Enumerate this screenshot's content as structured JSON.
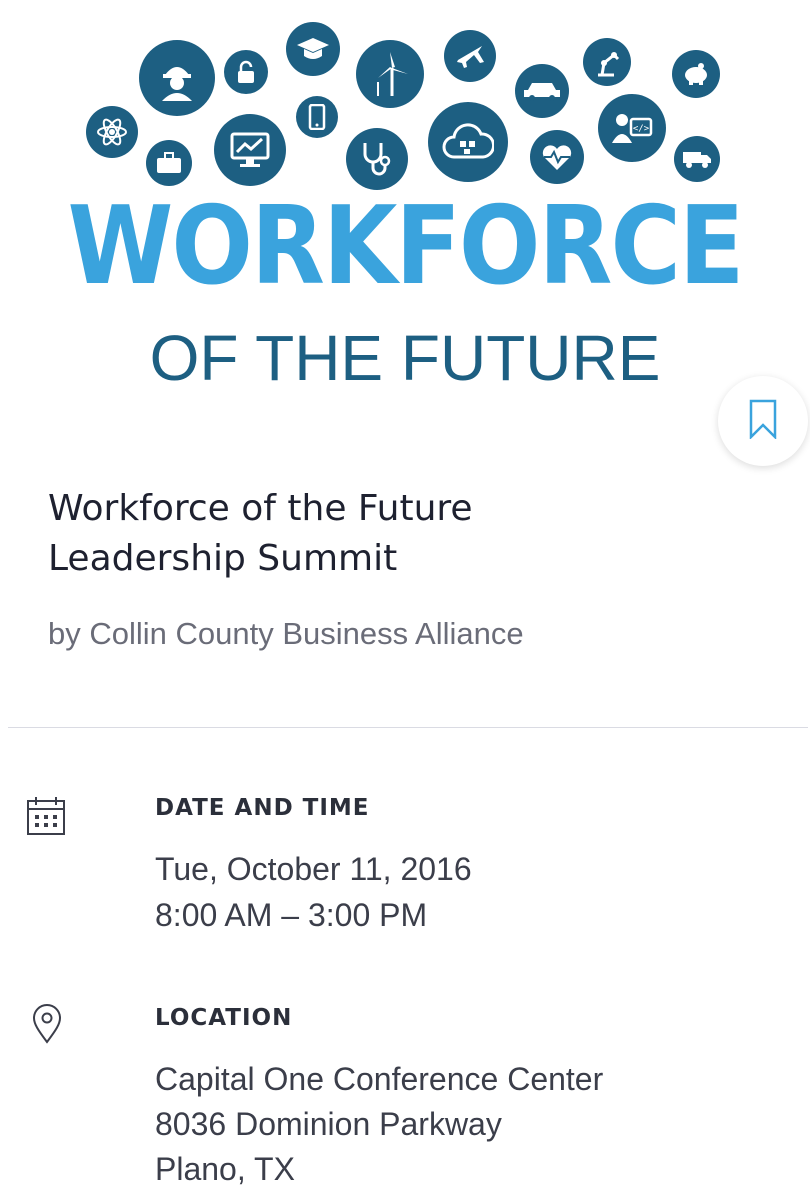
{
  "colors": {
    "brand_light": "#3aa3dd",
    "brand_dark": "#1d5f82",
    "accent": "#3aa3dd"
  },
  "hero": {
    "icons": [
      "worker-icon",
      "lock-icon",
      "graduation-cap-icon",
      "wind-turbine-icon",
      "airplane-icon",
      "car-icon",
      "robot-arm-icon",
      "piggy-bank-icon",
      "atom-icon",
      "briefcase-icon",
      "chart-monitor-icon",
      "smartphone-icon",
      "stethoscope-icon",
      "cloud-social-icon",
      "heart-monitor-icon",
      "developer-icon",
      "truck-icon"
    ],
    "logo_line1": "WORKFORCE",
    "logo_line2": "OF THE FUTURE"
  },
  "event": {
    "title_line1": "Workforce of the Future",
    "title_line2": "Leadership Summit",
    "organizer": "by Collin County Business Alliance"
  },
  "date_time": {
    "label": "DATE AND TIME",
    "date": "Tue, October 11, 2016",
    "time": "8:00 AM – 3:00 PM"
  },
  "location": {
    "label": "LOCATION",
    "venue": "Capital One Conference Center",
    "street": "8036 Dominion Parkway",
    "city": "Plano, TX"
  }
}
